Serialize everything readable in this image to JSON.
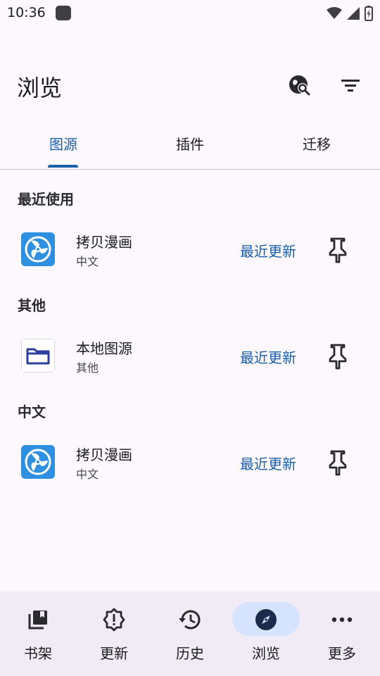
{
  "status": {
    "time": "10:36"
  },
  "appbar": {
    "title": "浏览",
    "globe_search_icon": "globe-search-icon",
    "filter_icon": "filter-icon"
  },
  "tabs": [
    {
      "label": "图源",
      "active": true
    },
    {
      "label": "插件",
      "active": false
    },
    {
      "label": "迁移",
      "active": false
    }
  ],
  "sections": [
    {
      "title": "最近使用",
      "items": [
        {
          "name": "拷贝漫画",
          "lang": "中文",
          "action": "最近更新",
          "icon": "copymanga-icon"
        }
      ]
    },
    {
      "title": "其他",
      "items": [
        {
          "name": "本地图源",
          "lang": "其他",
          "action": "最近更新",
          "icon": "folder-icon"
        }
      ]
    },
    {
      "title": "中文",
      "items": [
        {
          "name": "拷贝漫画",
          "lang": "中文",
          "action": "最近更新",
          "icon": "copymanga-icon"
        }
      ]
    }
  ],
  "bottom_nav": [
    {
      "label": "书架",
      "icon": "library-icon",
      "active": false
    },
    {
      "label": "更新",
      "icon": "updates-icon",
      "active": false
    },
    {
      "label": "历史",
      "icon": "history-icon",
      "active": false
    },
    {
      "label": "浏览",
      "icon": "browse-compass-icon",
      "active": true
    },
    {
      "label": "更多",
      "icon": "more-icon",
      "active": false
    }
  ],
  "colors": {
    "accent": "#1a5ea8",
    "background": "#fcf8fd",
    "nav_bg": "#f0ebf4",
    "active_pill": "#d6e3ff"
  }
}
